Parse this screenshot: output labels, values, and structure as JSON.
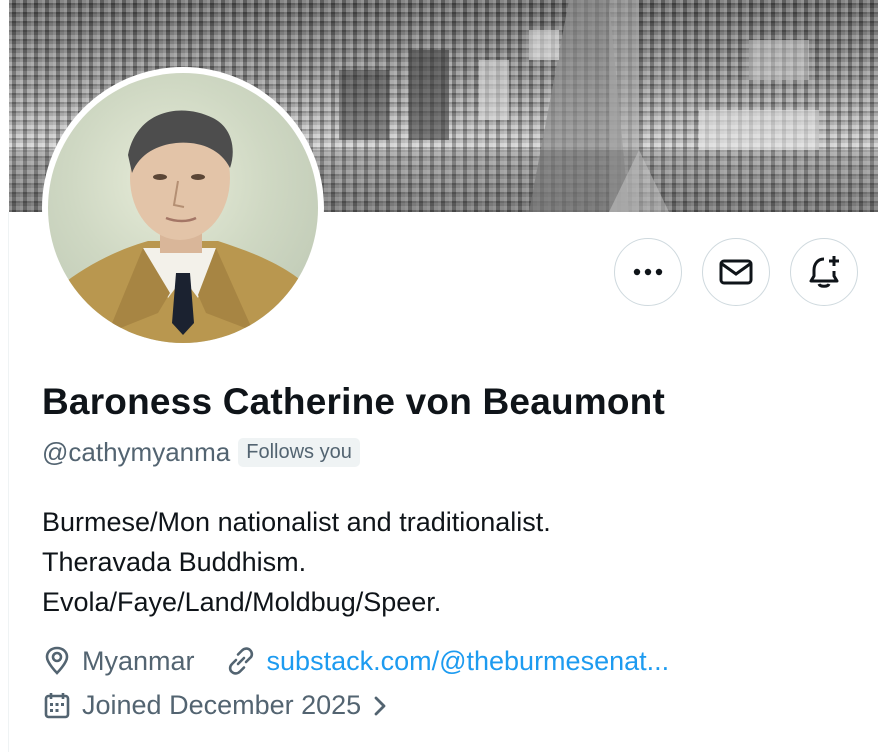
{
  "profile": {
    "display_name": "Baroness Catherine von Beaumont",
    "handle": "@cathymyanma",
    "follows_badge": "Follows you",
    "bio_lines": [
      "Burmese/Mon nationalist and traditionalist.",
      "Theravada Buddhism.",
      "Evola/Faye/Land/Moldbug/Speer."
    ],
    "location": "Myanmar",
    "website": "substack.com/@theburmesenat...",
    "joined": "Joined December 2025"
  },
  "actions": {
    "more_icon": "more-horizontal-icon",
    "message_icon": "envelope-icon",
    "notify_icon": "bell-plus-icon"
  },
  "icons": {
    "location": "map-pin-icon",
    "website": "link-icon",
    "joined": "calendar-icon",
    "joined_chevron": "chevron-right-icon"
  },
  "colors": {
    "text_primary": "#0f1419",
    "text_secondary": "#536471",
    "link": "#1d9bf0",
    "border": "#cfd9de",
    "badge_bg": "#eff3f4"
  }
}
